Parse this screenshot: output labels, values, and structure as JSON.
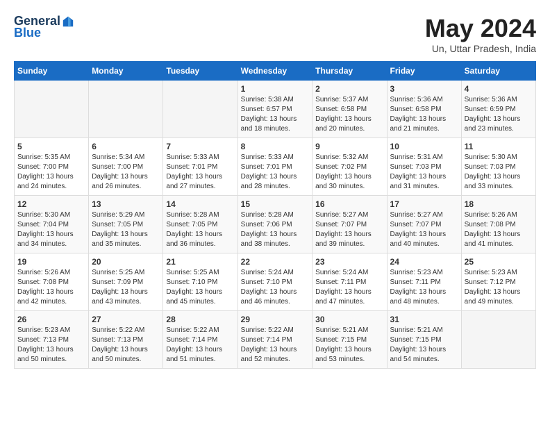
{
  "header": {
    "logo_general": "General",
    "logo_blue": "Blue",
    "month_title": "May 2024",
    "location": "Un, Uttar Pradesh, India"
  },
  "weekdays": [
    "Sunday",
    "Monday",
    "Tuesday",
    "Wednesday",
    "Thursday",
    "Friday",
    "Saturday"
  ],
  "weeks": [
    [
      {
        "day": "",
        "info": ""
      },
      {
        "day": "",
        "info": ""
      },
      {
        "day": "",
        "info": ""
      },
      {
        "day": "1",
        "info": "Sunrise: 5:38 AM\nSunset: 6:57 PM\nDaylight: 13 hours\nand 18 minutes."
      },
      {
        "day": "2",
        "info": "Sunrise: 5:37 AM\nSunset: 6:58 PM\nDaylight: 13 hours\nand 20 minutes."
      },
      {
        "day": "3",
        "info": "Sunrise: 5:36 AM\nSunset: 6:58 PM\nDaylight: 13 hours\nand 21 minutes."
      },
      {
        "day": "4",
        "info": "Sunrise: 5:36 AM\nSunset: 6:59 PM\nDaylight: 13 hours\nand 23 minutes."
      }
    ],
    [
      {
        "day": "5",
        "info": "Sunrise: 5:35 AM\nSunset: 7:00 PM\nDaylight: 13 hours\nand 24 minutes."
      },
      {
        "day": "6",
        "info": "Sunrise: 5:34 AM\nSunset: 7:00 PM\nDaylight: 13 hours\nand 26 minutes."
      },
      {
        "day": "7",
        "info": "Sunrise: 5:33 AM\nSunset: 7:01 PM\nDaylight: 13 hours\nand 27 minutes."
      },
      {
        "day": "8",
        "info": "Sunrise: 5:33 AM\nSunset: 7:01 PM\nDaylight: 13 hours\nand 28 minutes."
      },
      {
        "day": "9",
        "info": "Sunrise: 5:32 AM\nSunset: 7:02 PM\nDaylight: 13 hours\nand 30 minutes."
      },
      {
        "day": "10",
        "info": "Sunrise: 5:31 AM\nSunset: 7:03 PM\nDaylight: 13 hours\nand 31 minutes."
      },
      {
        "day": "11",
        "info": "Sunrise: 5:30 AM\nSunset: 7:03 PM\nDaylight: 13 hours\nand 33 minutes."
      }
    ],
    [
      {
        "day": "12",
        "info": "Sunrise: 5:30 AM\nSunset: 7:04 PM\nDaylight: 13 hours\nand 34 minutes."
      },
      {
        "day": "13",
        "info": "Sunrise: 5:29 AM\nSunset: 7:05 PM\nDaylight: 13 hours\nand 35 minutes."
      },
      {
        "day": "14",
        "info": "Sunrise: 5:28 AM\nSunset: 7:05 PM\nDaylight: 13 hours\nand 36 minutes."
      },
      {
        "day": "15",
        "info": "Sunrise: 5:28 AM\nSunset: 7:06 PM\nDaylight: 13 hours\nand 38 minutes."
      },
      {
        "day": "16",
        "info": "Sunrise: 5:27 AM\nSunset: 7:07 PM\nDaylight: 13 hours\nand 39 minutes."
      },
      {
        "day": "17",
        "info": "Sunrise: 5:27 AM\nSunset: 7:07 PM\nDaylight: 13 hours\nand 40 minutes."
      },
      {
        "day": "18",
        "info": "Sunrise: 5:26 AM\nSunset: 7:08 PM\nDaylight: 13 hours\nand 41 minutes."
      }
    ],
    [
      {
        "day": "19",
        "info": "Sunrise: 5:26 AM\nSunset: 7:08 PM\nDaylight: 13 hours\nand 42 minutes."
      },
      {
        "day": "20",
        "info": "Sunrise: 5:25 AM\nSunset: 7:09 PM\nDaylight: 13 hours\nand 43 minutes."
      },
      {
        "day": "21",
        "info": "Sunrise: 5:25 AM\nSunset: 7:10 PM\nDaylight: 13 hours\nand 45 minutes."
      },
      {
        "day": "22",
        "info": "Sunrise: 5:24 AM\nSunset: 7:10 PM\nDaylight: 13 hours\nand 46 minutes."
      },
      {
        "day": "23",
        "info": "Sunrise: 5:24 AM\nSunset: 7:11 PM\nDaylight: 13 hours\nand 47 minutes."
      },
      {
        "day": "24",
        "info": "Sunrise: 5:23 AM\nSunset: 7:11 PM\nDaylight: 13 hours\nand 48 minutes."
      },
      {
        "day": "25",
        "info": "Sunrise: 5:23 AM\nSunset: 7:12 PM\nDaylight: 13 hours\nand 49 minutes."
      }
    ],
    [
      {
        "day": "26",
        "info": "Sunrise: 5:23 AM\nSunset: 7:13 PM\nDaylight: 13 hours\nand 50 minutes."
      },
      {
        "day": "27",
        "info": "Sunrise: 5:22 AM\nSunset: 7:13 PM\nDaylight: 13 hours\nand 50 minutes."
      },
      {
        "day": "28",
        "info": "Sunrise: 5:22 AM\nSunset: 7:14 PM\nDaylight: 13 hours\nand 51 minutes."
      },
      {
        "day": "29",
        "info": "Sunrise: 5:22 AM\nSunset: 7:14 PM\nDaylight: 13 hours\nand 52 minutes."
      },
      {
        "day": "30",
        "info": "Sunrise: 5:21 AM\nSunset: 7:15 PM\nDaylight: 13 hours\nand 53 minutes."
      },
      {
        "day": "31",
        "info": "Sunrise: 5:21 AM\nSunset: 7:15 PM\nDaylight: 13 hours\nand 54 minutes."
      },
      {
        "day": "",
        "info": ""
      }
    ]
  ]
}
